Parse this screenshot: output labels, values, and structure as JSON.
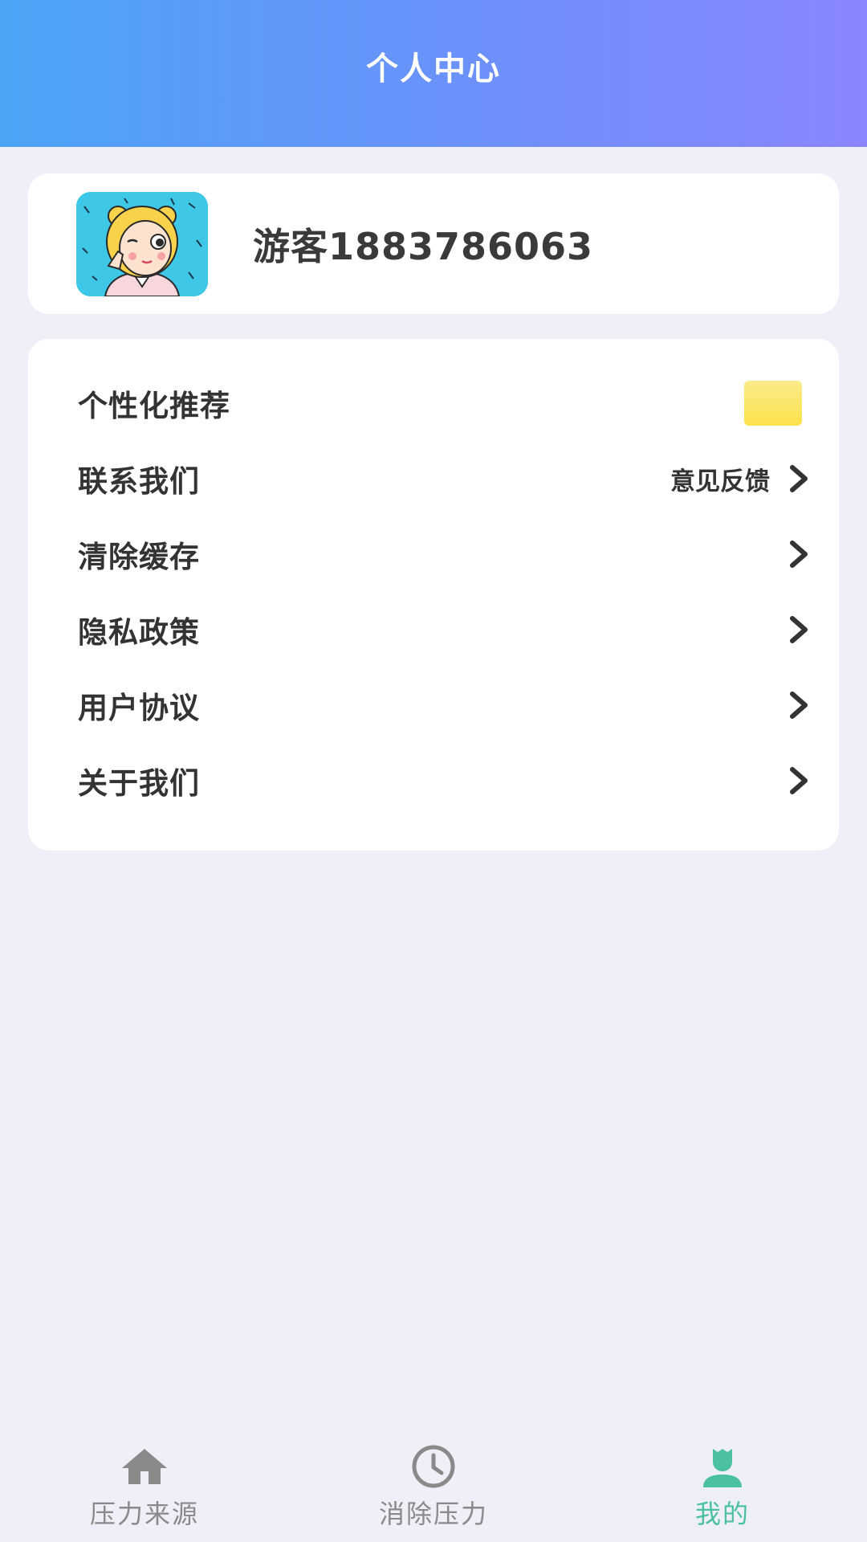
{
  "header": {
    "title": "个人中心"
  },
  "profile": {
    "username": "游客1883786063"
  },
  "menu": {
    "items": [
      {
        "label": "个性化推荐",
        "type": "toggle"
      },
      {
        "label": "联系我们",
        "extra": "意见反馈",
        "type": "link"
      },
      {
        "label": "清除缓存",
        "type": "link"
      },
      {
        "label": "隐私政策",
        "type": "link"
      },
      {
        "label": "用户协议",
        "type": "link"
      },
      {
        "label": "关于我们",
        "type": "link"
      }
    ]
  },
  "tabbar": {
    "tabs": [
      {
        "label": "压力来源",
        "icon": "home-icon",
        "active": false
      },
      {
        "label": "消除压力",
        "icon": "clock-icon",
        "active": false
      },
      {
        "label": "我的",
        "icon": "user-icon",
        "active": true
      }
    ]
  },
  "colors": {
    "header_start": "#4ca4f7",
    "header_end": "#8a86fd",
    "background": "#eff0f7",
    "active_tab": "#4cc1a2",
    "toggle": "#fde24a"
  }
}
